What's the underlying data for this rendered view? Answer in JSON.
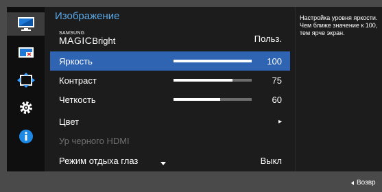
{
  "menu": {
    "title": "Изображение",
    "magic_bright": {
      "brand_small": "SAMSUNG",
      "brand_big": "MAGIC",
      "suffix": "Bright",
      "value": "Польз."
    },
    "rows": [
      {
        "label": "Яркость",
        "value": "100",
        "level": 1.0,
        "selected": true
      },
      {
        "label": "Контраст",
        "value": "75",
        "level": 0.75
      },
      {
        "label": "Четкость",
        "value": "60",
        "level": 0.6
      }
    ],
    "color_label": "Цвет",
    "color_arrow": "▸",
    "hdmi_black_label": "Ур черного HDMI",
    "eye_saver_label": "Режим отдыха глаз",
    "eye_saver_value": "Выкл"
  },
  "side_icons": [
    "monitor-picture-icon",
    "picture-size-icon",
    "position-arrows-icon",
    "settings-gear-icon",
    "info-icon"
  ],
  "help": {
    "text": "Настройка уровня яркости. Чем ближе значение к 100, тем ярче экран."
  },
  "footer": {
    "return_label": "Возвр"
  },
  "colors": {
    "highlight": "#2f64b3",
    "title_blue": "#5aa9e8",
    "info_blue": "#1e88e5"
  }
}
